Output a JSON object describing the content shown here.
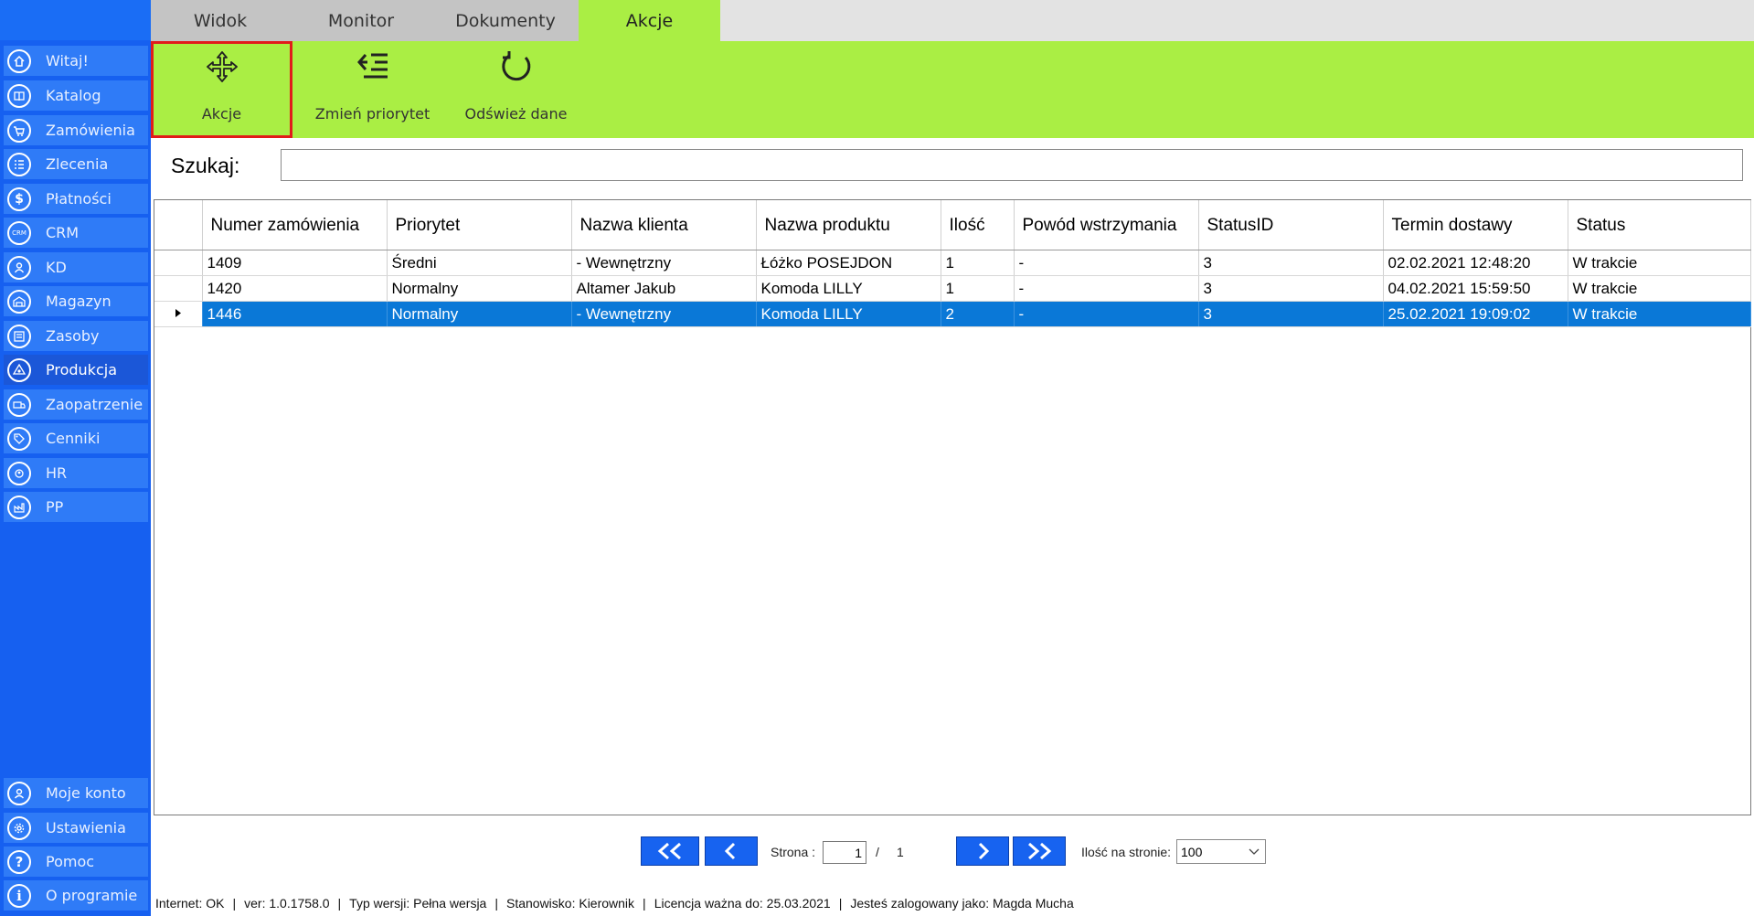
{
  "sidebar": {
    "items": [
      {
        "label": "Witaj!",
        "icon": "home-icon"
      },
      {
        "label": "Katalog",
        "icon": "book-icon"
      },
      {
        "label": "Zamówienia",
        "icon": "cart-icon"
      },
      {
        "label": "Zlecenia",
        "icon": "list-icon"
      },
      {
        "label": "Płatności",
        "icon": "dollar-icon"
      },
      {
        "label": "CRM",
        "icon": "crm-icon"
      },
      {
        "label": "KD",
        "icon": "person-icon"
      },
      {
        "label": "Magazyn",
        "icon": "warehouse-icon"
      },
      {
        "label": "Zasoby",
        "icon": "resources-icon"
      },
      {
        "label": "Produkcja",
        "icon": "production-icon"
      },
      {
        "label": "Zaopatrzenie",
        "icon": "truck-icon"
      },
      {
        "label": "Cenniki",
        "icon": "tag-icon"
      },
      {
        "label": "HR",
        "icon": "hr-icon"
      },
      {
        "label": "PP",
        "icon": "pp-icon"
      }
    ],
    "active": "Produkcja",
    "bottom_items": [
      {
        "label": "Moje konto",
        "icon": "user-icon"
      },
      {
        "label": "Ustawienia",
        "icon": "gear-icon"
      },
      {
        "label": "Pomoc",
        "icon": "help-icon"
      },
      {
        "label": "O programie",
        "icon": "info-icon"
      }
    ]
  },
  "tabs": [
    {
      "label": "Widok"
    },
    {
      "label": "Monitor"
    },
    {
      "label": "Dokumenty"
    },
    {
      "label": "Akcje"
    }
  ],
  "active_tab": "Akcje",
  "ribbon": {
    "actions_label": "Akcje",
    "change_priority_label": "Zmień priorytet",
    "refresh_label": "Odśwież dane"
  },
  "search": {
    "label": "Szukaj:",
    "value": ""
  },
  "grid": {
    "columns": [
      "Numer zamówienia",
      "Priorytet",
      "Nazwa klienta",
      "Nazwa produktu",
      "Ilość",
      "Powód wstrzymania",
      "StatusID",
      "Termin dostawy",
      "Status"
    ],
    "rows": [
      [
        "1409",
        "Średni",
        "- Wewnętrzny",
        "Łóżko POSEJDON",
        "1",
        "-",
        "3",
        "02.02.2021 12:48:20",
        "W trakcie"
      ],
      [
        "1420",
        "Normalny",
        "Altamer Jakub",
        "Komoda LILLY",
        "1",
        "-",
        "3",
        "04.02.2021 15:59:50",
        "W trakcie"
      ],
      [
        "1446",
        "Normalny",
        "- Wewnętrzny",
        "Komoda LILLY",
        "2",
        "-",
        "3",
        "25.02.2021 19:09:02",
        "W trakcie"
      ]
    ],
    "selected_row": 2
  },
  "pager": {
    "page_label": "Strona :",
    "current_page": "1",
    "separator": "/",
    "total_pages": "1",
    "per_page_label": "Ilość na stronie:",
    "per_page_value": "100"
  },
  "status": {
    "internet": "Internet: OK",
    "version": "ver: 1.0.1758.0",
    "version_type": "Typ wersji: Pełna wersja",
    "workstation": "Stanowisko: Kierownik",
    "license": "Licencja ważna do: 25.03.2021",
    "user": "Jesteś zalogowany jako: Magda Mucha"
  },
  "colors": {
    "sidebar": "#1660f0",
    "ribbon": "#aaee44",
    "selected_row": "#0a78d7",
    "highlight_border": "#e11b1b"
  }
}
